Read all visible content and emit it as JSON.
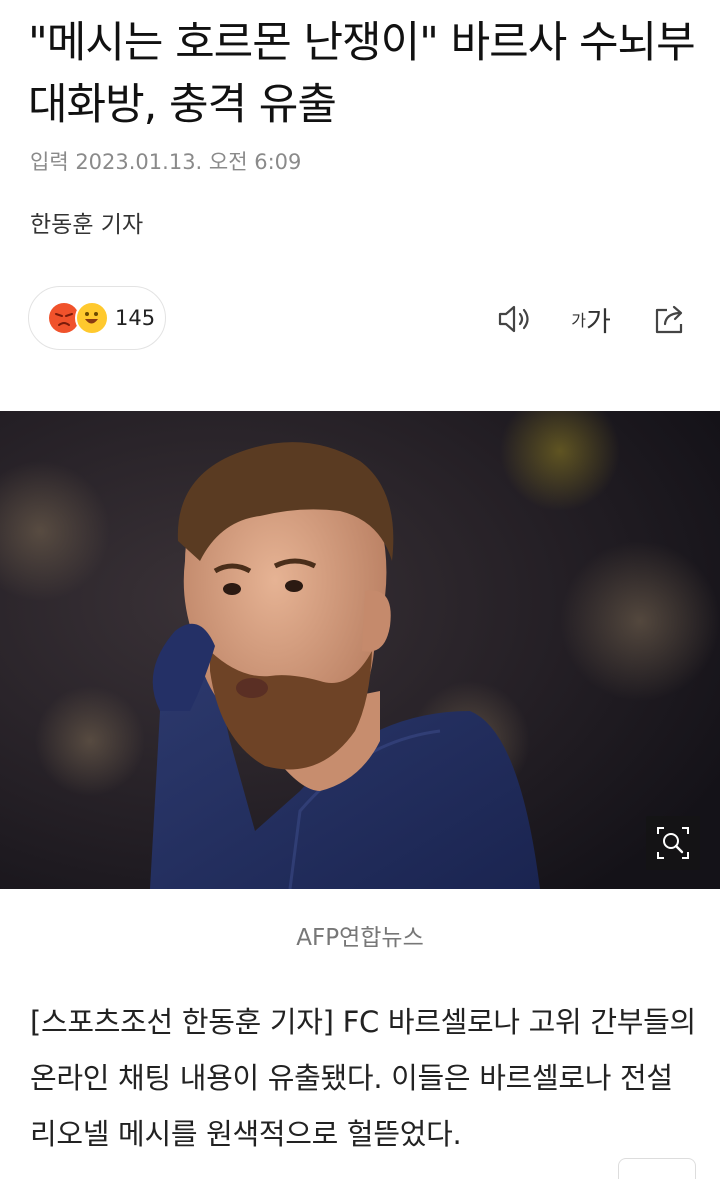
{
  "article": {
    "headline": "\"메시는 호르몬 난쟁이\" 바르사 수뇌부 대화방, 충격 유출",
    "date": "입력 2023.01.13. 오전 6:09",
    "byline": "한동훈 기자",
    "photo_caption": "AFP연합뉴스",
    "body": "[스포츠조선 한동훈 기자] FC 바르셀로나 고위 간부들의 온라인 채팅 내용이 유출됐다. 이들은 바르셀로나 전설 리오넬 메시를 원색적으로 헐뜯었다."
  },
  "reactions": {
    "count": "145",
    "icons": [
      "angry-face",
      "grinning-face"
    ]
  },
  "toolbar": {
    "audio_icon": "speaker-icon",
    "font_small": "가",
    "font_big": "가",
    "share_icon": "share-icon"
  },
  "photo": {
    "subject": "photo",
    "zoom_icon": "zoom-icon"
  },
  "colors": {
    "background": "#ffffff",
    "text": "#111111",
    "muted": "#8a8a8a",
    "angry": "#f0522b",
    "happy": "#ffc92e"
  }
}
